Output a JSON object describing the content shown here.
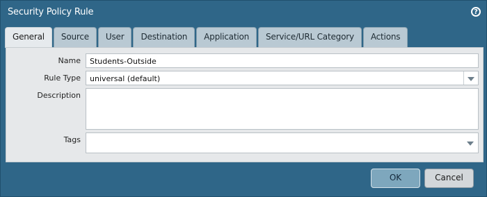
{
  "dialog": {
    "title": "Security Policy Rule",
    "help_icon": "help-circle-icon"
  },
  "tabs": [
    {
      "label": "General",
      "active": true
    },
    {
      "label": "Source",
      "active": false
    },
    {
      "label": "User",
      "active": false
    },
    {
      "label": "Destination",
      "active": false
    },
    {
      "label": "Application",
      "active": false
    },
    {
      "label": "Service/URL Category",
      "active": false
    },
    {
      "label": "Actions",
      "active": false
    }
  ],
  "form": {
    "name": {
      "label": "Name",
      "value": "Students-Outside"
    },
    "rule_type": {
      "label": "Rule Type",
      "value": "universal (default)"
    },
    "description": {
      "label": "Description",
      "value": ""
    },
    "tags": {
      "label": "Tags",
      "value": ""
    }
  },
  "buttons": {
    "ok": "OK",
    "cancel": "Cancel"
  },
  "colors": {
    "background": "#2f6688",
    "panel": "#e6e8ea",
    "tab_inactive": "#b9c9d3",
    "ok_button": "#7ea7bd"
  }
}
